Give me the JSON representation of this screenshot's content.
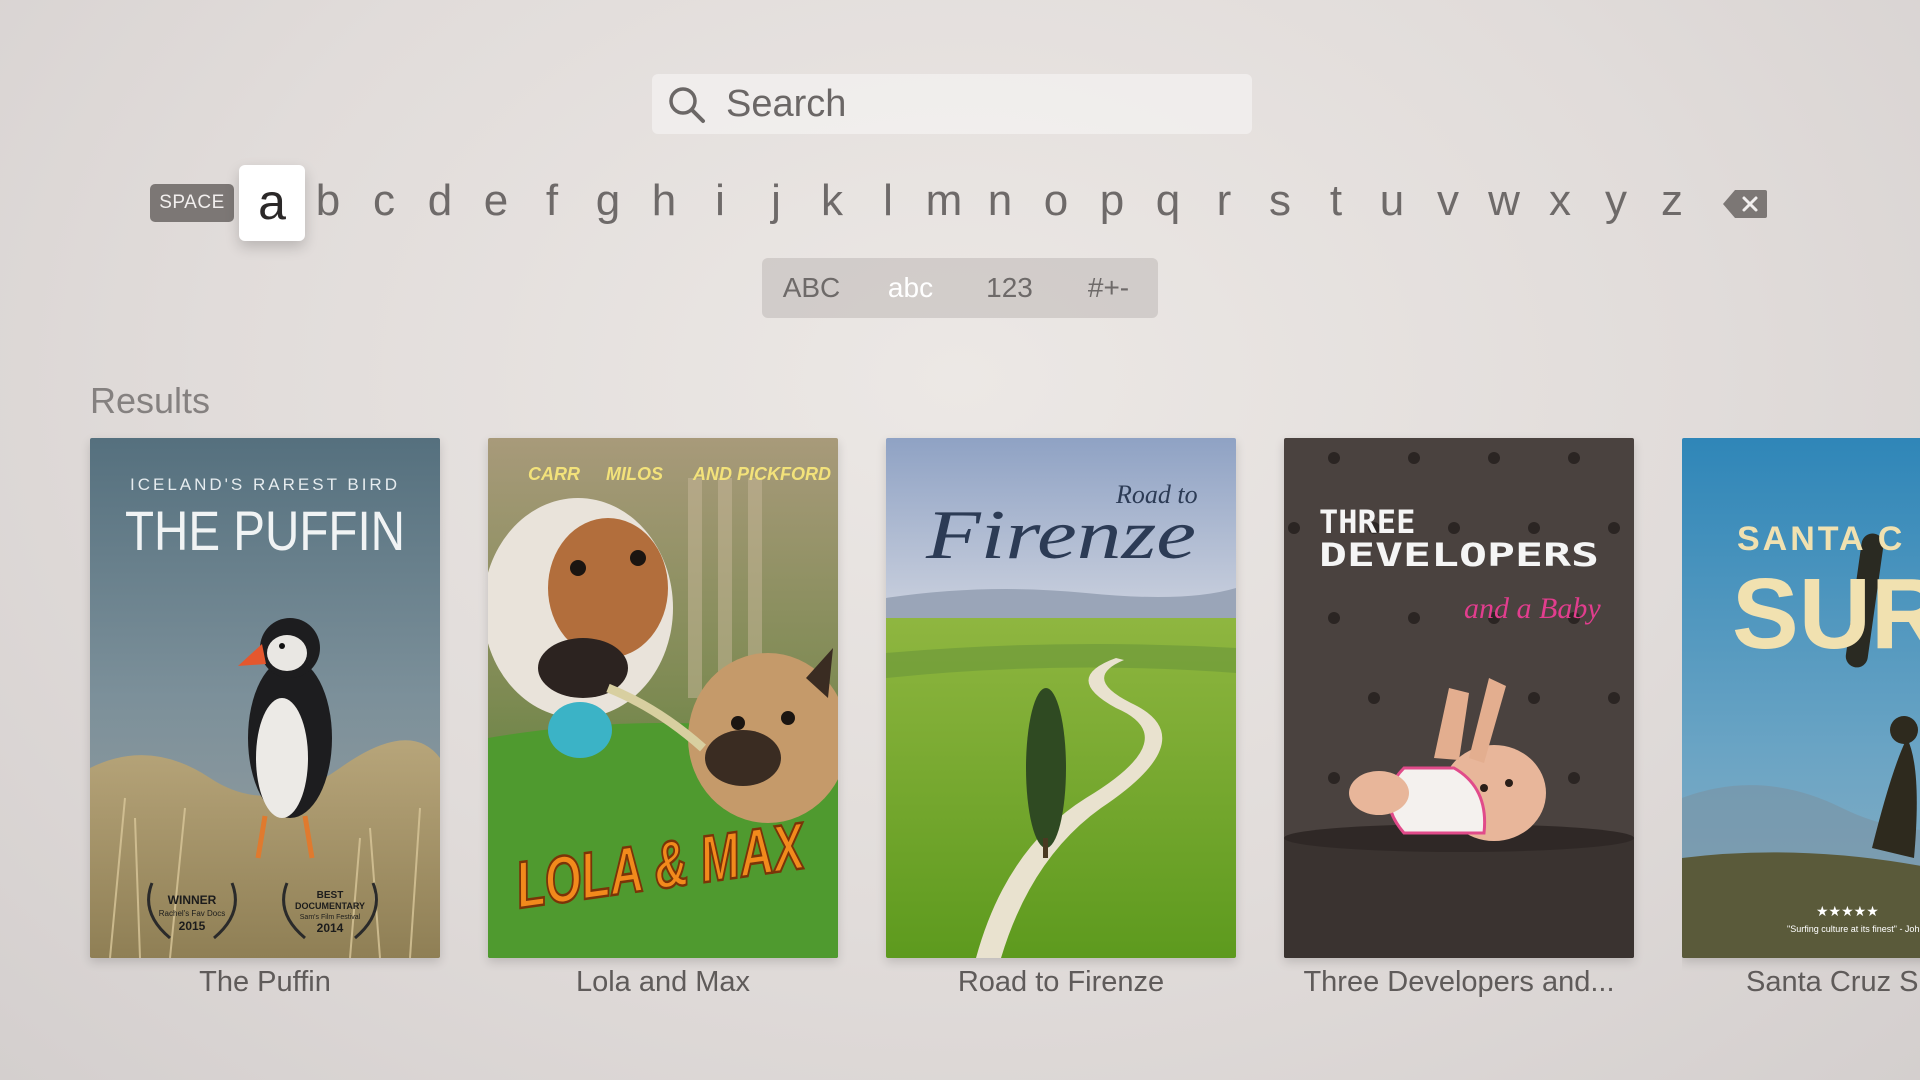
{
  "search": {
    "placeholder": "Search",
    "icon": "magnifier"
  },
  "keyboard": {
    "space_label": "SPACE",
    "letters": [
      "a",
      "b",
      "c",
      "d",
      "e",
      "f",
      "g",
      "h",
      "i",
      "j",
      "k",
      "l",
      "m",
      "n",
      "o",
      "p",
      "q",
      "r",
      "s",
      "t",
      "u",
      "v",
      "w",
      "x",
      "y",
      "z"
    ],
    "selected_letter": "a",
    "delete_icon": "backspace-icon"
  },
  "modes": [
    {
      "label": "ABC"
    },
    {
      "label": "abc",
      "active": true
    },
    {
      "label": "123"
    },
    {
      "label": "#+-"
    }
  ],
  "results": {
    "title": "Results",
    "items": [
      {
        "title": "The Puffin",
        "poster": {
          "tagline": "ICELAND'S RAREST BIRD",
          "headline": "THE PUFFIN",
          "laurel_1": [
            "WINNER",
            "Rachel's Fav Docs",
            "2015"
          ],
          "laurel_2": [
            "BEST",
            "DOCUMENTARY",
            "Sam's Film Festival",
            "2014"
          ]
        }
      },
      {
        "title": "Lola and Max",
        "poster": {
          "credits": [
            "CARR",
            "MILOS",
            "AND PICKFORD"
          ],
          "headline": "LOLA & MAX"
        }
      },
      {
        "title": "Road to Firenze",
        "poster": {
          "headline_small": "Road to",
          "headline": "Firenze"
        }
      },
      {
        "title": "Three Developers and...",
        "poster": {
          "headline_1": "THREE",
          "headline_2": "DEVELOPERS",
          "subhead": "and a Baby"
        }
      },
      {
        "title": "Santa Cruz S",
        "poster": {
          "headline_small": "SANTA C",
          "headline": "SUR",
          "stars": "★★★★★",
          "quote": "\"Surfing culture at its finest\" - Joh"
        }
      }
    ]
  },
  "colors": {
    "selected_key_bg": "#ffffff",
    "active_mode_text": "#ffffff",
    "background": "#e3dedc"
  }
}
